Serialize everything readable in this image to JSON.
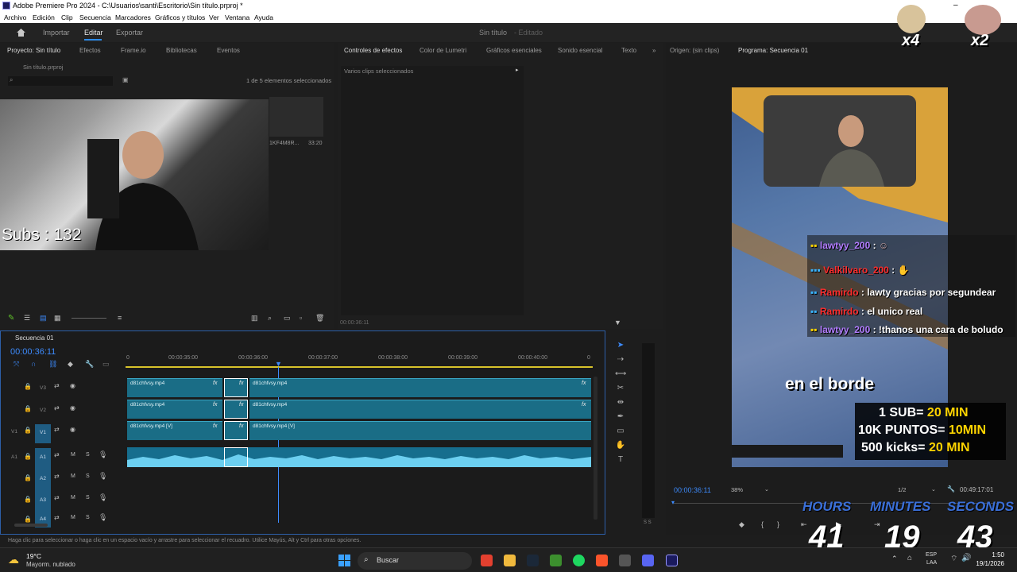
{
  "titlebar": {
    "title": "Adobe Premiere Pro 2024 - C:\\Usuarios\\santi\\Escritorio\\Sin título.prproj *"
  },
  "menubar": {
    "items": [
      "Archivo",
      "Edición",
      "Clip",
      "Secuencia",
      "Marcadores",
      "Gráficos y títulos",
      "Ver",
      "Ventana",
      "Ayuda"
    ]
  },
  "workspace": {
    "tabs": [
      "Importar",
      "Editar",
      "Exportar"
    ],
    "project_title": "Sin título",
    "project_state": "- Editado"
  },
  "project_panel": {
    "tabs": [
      "Proyecto: Sin título",
      "Efectos",
      "Frame.io",
      "Bibliotecas",
      "Eventos"
    ],
    "file": "Sin título.prproj",
    "selection_status": "1 de 5 elementos seleccionados",
    "search_placeholder": "",
    "item_name": "1KF4M8R...",
    "item_duration": "33:20",
    "subs_overlay": "Subs : 132"
  },
  "effects_panel": {
    "tabs": [
      "Controles de efectos",
      "Color de Lumetri",
      "Gráficos esenciales",
      "Sonido esencial",
      "Texto"
    ],
    "message": "Varios clips seleccionados",
    "timecode": "00:00:36:11"
  },
  "program_panel": {
    "tabs": [
      "Origen: (sin clips)",
      "Programa: Secuencia 01"
    ],
    "timecode": "00:00:36:11",
    "zoom": "38%",
    "resolution": "1/2",
    "duration": "00:49:17:01"
  },
  "timeline": {
    "tab": "Secuencia 01",
    "timecode": "00:00:36:11",
    "ruler": [
      "0",
      "00:00:35:00",
      "00:00:36:00",
      "00:00:37:00",
      "00:00:38:00",
      "00:00:39:00",
      "00:00:40:00",
      "0"
    ],
    "tracks": [
      {
        "name": "V3",
        "clips": [
          "d81chfvsy.mp4",
          "d81chfvsy.mp4"
        ]
      },
      {
        "name": "V2",
        "clips": [
          "d81chfvsy.mp4",
          "d81chfvsy.mp4"
        ]
      },
      {
        "name": "V1",
        "clips": [
          "d81chfvsy.mp4 [V]",
          "d81chfvsy.mp4 [V]"
        ]
      },
      {
        "name": "A1"
      },
      {
        "name": "A2"
      },
      {
        "name": "A3"
      },
      {
        "name": "A4"
      }
    ],
    "track_buttons": {
      "mute": "M",
      "solo": "S"
    },
    "track_left_labels": [
      "V1",
      "A1"
    ],
    "meter_labels": "S S"
  },
  "status_bar": {
    "text": "Haga clic para seleccionar o haga clic en un espacio vacío y arrastre para seleccionar el recuadro. Utilice Mayús, Alt y Ctrl para otras opciones."
  },
  "stream_overlay": {
    "sticker_counts": [
      "x4",
      "x2"
    ],
    "chat": [
      {
        "user": "lawtyy_200",
        "msg": ""
      },
      {
        "user": "Valkilvaro_200",
        "msg": ""
      },
      {
        "user": "Ramirdo",
        "msg": "lawty gracias por segundear"
      },
      {
        "user": "Ramirdo",
        "msg": "el unico real"
      },
      {
        "user": "lawtyy_200",
        "msg": "!thanos una cara de boludo"
      }
    ],
    "caption": "en el borde",
    "rewards": [
      {
        "label": "1 SUB=",
        "value": "20 MIN"
      },
      {
        "label": "10K PUNTOS=",
        "value": "10MIN"
      },
      {
        "label": "500 kicks=",
        "value": "20 MIN"
      }
    ],
    "timer_labels": [
      "HOURS",
      "MINUTES",
      "SECONDS"
    ],
    "timer_values": [
      "41",
      "19",
      "43"
    ],
    "accent_color": "#3a6fd8",
    "reward_color": "#ffd400"
  },
  "taskbar": {
    "weather_temp": "19°C",
    "weather_desc": "Mayorm. nublado",
    "search_placeholder": "Buscar",
    "lang": "ESP",
    "lang2": "LAA",
    "time": "1:50",
    "date": "19/1/2026"
  }
}
